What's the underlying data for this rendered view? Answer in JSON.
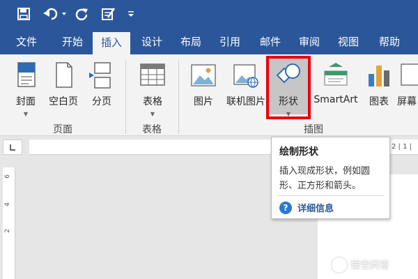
{
  "ribbon_tabs": [
    {
      "label": "文件"
    },
    {
      "label": "开始"
    },
    {
      "label": "插入"
    },
    {
      "label": "设计"
    },
    {
      "label": "布局"
    },
    {
      "label": "引用"
    },
    {
      "label": "邮件"
    },
    {
      "label": "审阅"
    },
    {
      "label": "视图"
    },
    {
      "label": "帮助"
    }
  ],
  "active_tab": "插入",
  "quick_access": {
    "icons": [
      "save-icon",
      "undo-icon",
      "redo-icon",
      "touch-mode-icon",
      "customize-qat-icon"
    ]
  },
  "groups": {
    "pages": {
      "label": "页面",
      "buttons": [
        {
          "label": "封面",
          "icon": "cover-page-icon"
        },
        {
          "label": "空白页",
          "icon": "blank-page-icon"
        },
        {
          "label": "分页",
          "icon": "page-break-icon"
        }
      ]
    },
    "tables": {
      "label": "表格",
      "buttons": [
        {
          "label": "表格",
          "icon": "table-icon"
        }
      ]
    },
    "illustrations": {
      "label": "插图",
      "buttons": [
        {
          "label": "图片",
          "icon": "picture-icon"
        },
        {
          "label": "联机图片",
          "icon": "online-picture-icon"
        },
        {
          "label": "形状",
          "icon": "shapes-icon"
        },
        {
          "label": "SmartArt",
          "icon": "smartart-icon"
        },
        {
          "label": "图表",
          "icon": "chart-icon"
        },
        {
          "label": "屏幕",
          "icon": "screenshot-icon"
        }
      ]
    }
  },
  "tooltip": {
    "title": "绘制形状",
    "description": "插入现成形状，例如圆形、正方形和箭头。",
    "more_info": "详细信息",
    "icon": "help-circle-icon"
  },
  "ruler": {
    "horizontal_visible": "2 | 1 |",
    "vertical_marks": [
      "6",
      "4",
      "2"
    ]
  },
  "watermark": {
    "text": "悟空问答",
    "icon": "wukong-logo-icon"
  },
  "colors": {
    "ribbon_blue": "#2b579a",
    "highlight_red": "#e8000b",
    "help_blue": "#2b78d2"
  }
}
